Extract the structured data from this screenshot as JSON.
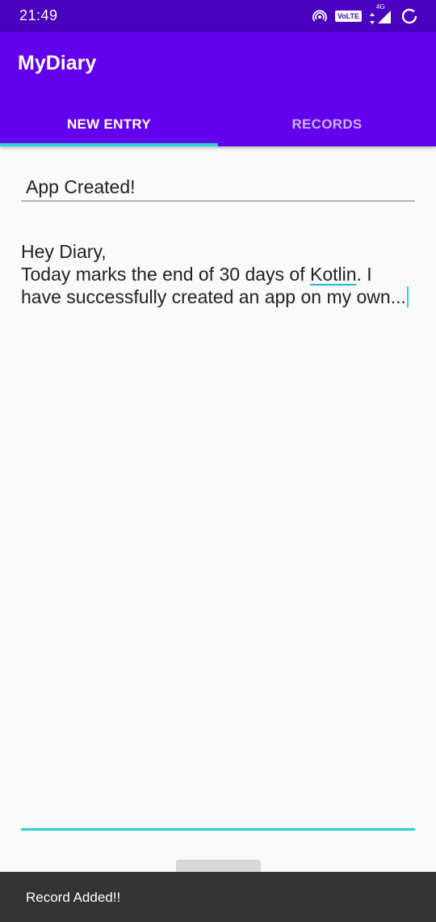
{
  "status_bar": {
    "time": "21:49",
    "volte_label": "VoLTE",
    "network_label": "4G",
    "icons": [
      "hotspot-icon",
      "volte-icon",
      "data-arrows-icon",
      "signal-icon",
      "battery-icon"
    ]
  },
  "app_bar": {
    "title": "MyDiary",
    "background_color": "#6200ee",
    "tabs": [
      {
        "label": "NEW ENTRY",
        "selected": true
      },
      {
        "label": "RECORDS",
        "selected": false
      }
    ],
    "indicator_color": "#27d3d3"
  },
  "entry": {
    "title_value": "App Created!",
    "body_lines": [
      "Hey Diary,",
      "Today marks the end of 30 days of ",
      "Kotlin",
      ". I",
      "have successfully created an app on my own..."
    ]
  },
  "snackbar": {
    "message": "Record Added!!"
  }
}
